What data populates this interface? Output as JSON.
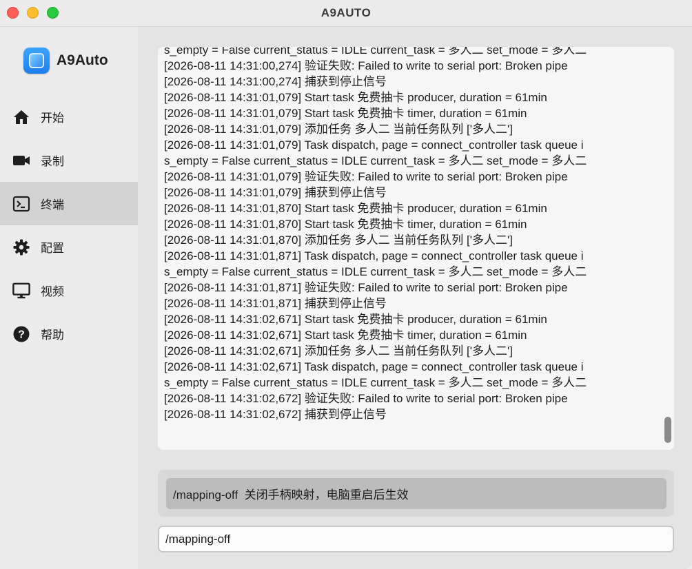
{
  "window": {
    "title": "A9AUTO"
  },
  "brand": {
    "name": "A9Auto"
  },
  "sidebar": {
    "items": [
      {
        "label": "开始",
        "icon": "home-icon"
      },
      {
        "label": "录制",
        "icon": "video-camera-icon"
      },
      {
        "label": "终端",
        "icon": "terminal-icon",
        "active": true
      },
      {
        "label": "配置",
        "icon": "gear-icon"
      },
      {
        "label": "视频",
        "icon": "monitor-icon"
      },
      {
        "label": "帮助",
        "icon": "help-icon"
      }
    ]
  },
  "log": {
    "lines": [
      "s_empty = False current_status = IDLE current_task = 多人二 set_mode = 多人二",
      "[2026-08-11 14:31:00,274] 验证失败: Failed to write to serial port: Broken pipe",
      "[2026-08-11 14:31:00,274] 捕获到停止信号",
      "[2026-08-11 14:31:01,079] Start task 免费抽卡 producer, duration = 61min",
      "[2026-08-11 14:31:01,079] Start task 免费抽卡 timer, duration = 61min",
      "[2026-08-11 14:31:01,079] 添加任务 多人二 当前任务队列 ['多人二']",
      "[2026-08-11 14:31:01,079] Task dispatch, page = connect_controller task queue i",
      "s_empty = False current_status = IDLE current_task = 多人二 set_mode = 多人二",
      "[2026-08-11 14:31:01,079] 验证失败: Failed to write to serial port: Broken pipe",
      "[2026-08-11 14:31:01,079] 捕获到停止信号",
      "[2026-08-11 14:31:01,870] Start task 免费抽卡 producer, duration = 61min",
      "[2026-08-11 14:31:01,870] Start task 免费抽卡 timer, duration = 61min",
      "[2026-08-11 14:31:01,870] 添加任务 多人二 当前任务队列 ['多人二']",
      "[2026-08-11 14:31:01,871] Task dispatch, page = connect_controller task queue i",
      "s_empty = False current_status = IDLE current_task = 多人二 set_mode = 多人二",
      "[2026-08-11 14:31:01,871] 验证失败: Failed to write to serial port: Broken pipe",
      "[2026-08-11 14:31:01,871] 捕获到停止信号",
      "[2026-08-11 14:31:02,671] Start task 免费抽卡 producer, duration = 61min",
      "[2026-08-11 14:31:02,671] Start task 免费抽卡 timer, duration = 61min",
      "[2026-08-11 14:31:02,671] 添加任务 多人二 当前任务队列 ['多人二']",
      "[2026-08-11 14:31:02,671] Task dispatch, page = connect_controller task queue i",
      "s_empty = False current_status = IDLE current_task = 多人二 set_mode = 多人二",
      "[2026-08-11 14:31:02,672] 验证失败: Failed to write to serial port: Broken pipe",
      "[2026-08-11 14:31:02,672] 捕获到停止信号"
    ]
  },
  "suggestion": {
    "text": "/mapping-off  关闭手柄映射，电脑重启后生效"
  },
  "command_input": {
    "value": "/mapping-off"
  },
  "colors": {
    "close": "#fe5f57",
    "minimize": "#febc2e",
    "maximize": "#28c840",
    "brand_blue": "#2e8bf0",
    "active_nav": "#d3d3d3"
  }
}
